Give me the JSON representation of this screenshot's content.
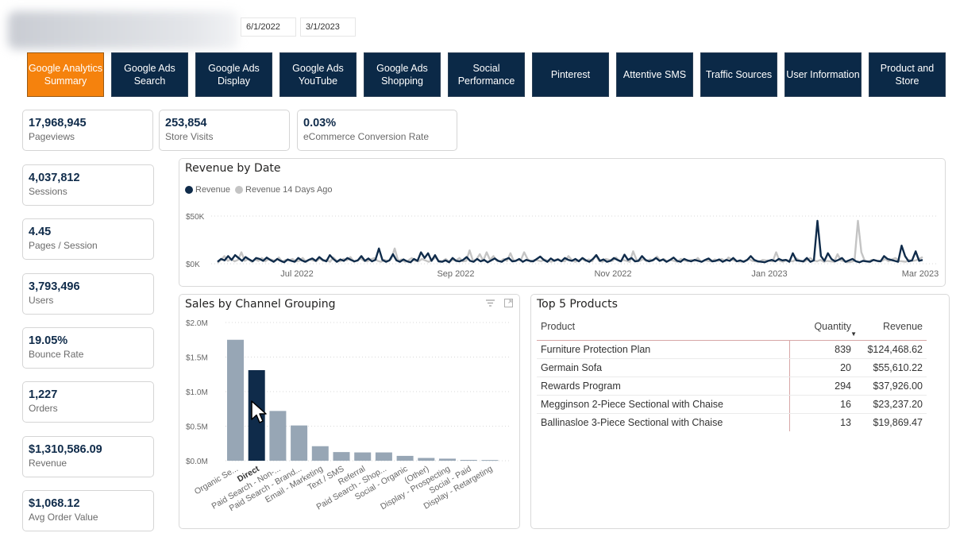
{
  "header": {
    "date_start": "6/1/2022",
    "date_end": "3/1/2023"
  },
  "nav": {
    "active_index": 0,
    "items": [
      {
        "label": "Google Analytics\nSummary"
      },
      {
        "label": "Google Ads\nSearch"
      },
      {
        "label": "Google Ads\nDisplay"
      },
      {
        "label": "Google Ads\nYouTube"
      },
      {
        "label": "Google Ads\nShopping"
      },
      {
        "label": "Social\nPerformance"
      },
      {
        "label": "Pinterest"
      },
      {
        "label": "Attentive SMS"
      },
      {
        "label": "Traffic Sources"
      },
      {
        "label": "User Information"
      },
      {
        "label": "Product and\nStore"
      }
    ]
  },
  "kpis_top": [
    {
      "value": "17,968,945",
      "label": "Pageviews"
    },
    {
      "value": "253,854",
      "label": "Store Visits"
    },
    {
      "value": "0.03%",
      "label": "eCommerce Conversion Rate"
    }
  ],
  "kpis_side": [
    {
      "value": "4,037,812",
      "label": "Sessions"
    },
    {
      "value": "4.45",
      "label": "Pages / Session"
    },
    {
      "value": "3,793,496",
      "label": "Users"
    },
    {
      "value": "19.05%",
      "label": "Bounce Rate"
    },
    {
      "value": "1,227",
      "label": "Orders"
    },
    {
      "value": "$1,310,586.09",
      "label": "Revenue"
    },
    {
      "value": "$1,068.12",
      "label": "Avg Order Value"
    }
  ],
  "colors": {
    "nav_bg": "#0b2947",
    "nav_active": "#f5820d",
    "series_revenue": "#0f2b4a",
    "series_prior": "#c4c4c4",
    "bar_default": "#97a6b5",
    "bar_selected": "#0f2b4a"
  },
  "revenue_chart": {
    "title": "Revenue by Date",
    "legend": [
      "Revenue",
      "Revenue 14 Days Ago"
    ]
  },
  "channel_chart": {
    "title": "Sales by Channel Grouping",
    "selected": "Direct"
  },
  "products": {
    "title": "Top 5 Products",
    "columns": [
      "Product",
      "Quantity",
      "Revenue"
    ],
    "sort_column": "Quantity",
    "rows": [
      {
        "product": "Furniture Protection Plan",
        "quantity": "839",
        "revenue": "$124,468.62"
      },
      {
        "product": "Germain Sofa",
        "quantity": "20",
        "revenue": "$55,610.22"
      },
      {
        "product": "Rewards Program",
        "quantity": "294",
        "revenue": "$37,926.00"
      },
      {
        "product": "Megginson 2-Piece Sectional with Chaise",
        "quantity": "16",
        "revenue": "$23,237.20"
      },
      {
        "product": "Ballinasloe 3-Piece Sectional with Chaise",
        "quantity": "13",
        "revenue": "$19,869.47"
      }
    ]
  },
  "chart_data": [
    {
      "type": "line",
      "title": "Revenue by Date",
      "xlabel": "",
      "ylabel": "",
      "x_tick_labels": [
        "Jul 2022",
        "Sep 2022",
        "Nov 2022",
        "Jan 2023",
        "Mar 2023"
      ],
      "y_tick_labels": [
        "$0K",
        "$50K"
      ],
      "ylim": [
        0,
        50000
      ],
      "x_range": [
        "2022-06-01",
        "2023-03-01"
      ],
      "legend_position": "top-left",
      "grid": true,
      "series": [
        {
          "name": "Revenue",
          "values": [
            2000,
            5000,
            3500,
            8000,
            4000,
            9000,
            6000,
            3000,
            7000,
            4500,
            2500,
            6000,
            5000,
            3000,
            6500,
            4000,
            2000,
            5000,
            3000,
            1500,
            4500,
            3000,
            2000,
            6000,
            3500,
            2000,
            4000,
            5500,
            3000,
            7000,
            4000,
            2500,
            9000,
            5000,
            2000,
            4500,
            3000,
            6000,
            4000,
            2500,
            3500,
            8000,
            3000,
            5500,
            2500,
            4000,
            16000,
            4000,
            2000,
            3500,
            10000,
            3500,
            2000,
            4500,
            2500,
            1500,
            5000,
            3000,
            12000,
            6000,
            11000,
            3000,
            9000,
            2500,
            2000,
            3500,
            1500,
            6000,
            3000,
            2500,
            4000,
            7000,
            3000,
            2000,
            5000,
            2500,
            4000,
            1500,
            3500,
            5500,
            3000,
            2000,
            4500,
            6000,
            2500,
            3000,
            5000,
            2000,
            4000,
            3000,
            2500,
            5000,
            7500,
            4000,
            2000,
            5500,
            3000,
            4500,
            2500,
            6000,
            4000,
            3000,
            5000,
            2500,
            6000,
            3500,
            2000,
            5000,
            9000,
            3000,
            4500,
            2000,
            3000,
            6000,
            4000,
            2500,
            9500,
            4000,
            6000,
            2500,
            3000,
            8000,
            4000,
            2500,
            3500,
            6000,
            3000,
            4500,
            2000,
            4000,
            6500,
            3000,
            2000,
            5000,
            3500,
            2500,
            4000,
            3000,
            2000,
            4000,
            5500,
            2500,
            3000,
            4500,
            2000,
            4000,
            3000,
            6000,
            2500,
            3500,
            2000,
            4000,
            8000,
            4000,
            2500,
            2000,
            1500,
            3000,
            4000,
            2500,
            5000,
            3500,
            4000,
            2000,
            11000,
            3500,
            3000,
            2500,
            6000,
            2000,
            3500,
            45000,
            8000,
            3000,
            11000,
            5000,
            2500,
            4000,
            6000,
            2000,
            3500,
            5000,
            2500,
            1500,
            3000,
            2500,
            2000,
            4000,
            3000,
            2500,
            8000,
            5000,
            4000,
            3000,
            2000,
            19000,
            8000,
            2500,
            3500,
            13000,
            3000,
            4000
          ]
        },
        {
          "name": "Revenue 14 Days Ago",
          "values": [
            1000,
            4000,
            8000,
            3000,
            5000,
            2500,
            4000,
            12000,
            3000,
            5000,
            2000,
            4500,
            3000,
            6000,
            2500,
            5000,
            4000,
            3000,
            6500,
            2000,
            4000,
            3500,
            5000,
            2500,
            3000,
            6000,
            2000,
            4500,
            3500,
            2500,
            5500,
            3000,
            4000,
            2000,
            6500,
            3000,
            2500,
            5000,
            3500,
            7000,
            2000,
            3500,
            5500,
            3000,
            2500,
            4500,
            6000,
            3000,
            2000,
            4000,
            3000,
            5000,
            16000,
            3000,
            4500,
            2000,
            3500,
            6000,
            3000,
            2500,
            5000,
            3500,
            2000,
            4000,
            6500,
            3000,
            2500,
            5000,
            2000,
            4000,
            3500,
            6000,
            2500,
            3000,
            14000,
            3000,
            4500,
            10000,
            3000,
            12000,
            4000,
            8000,
            3000,
            2500,
            5000,
            3000,
            11000,
            2500,
            4000,
            3500,
            12000,
            5000,
            2000,
            4000,
            3500,
            2500,
            4500,
            3000,
            2000,
            4000,
            5000,
            3000,
            2500,
            8000,
            4000,
            2000,
            3500,
            5000,
            3000,
            4500,
            2500,
            9000,
            3000,
            2000,
            5000,
            4000,
            3000,
            6500,
            2500,
            4000,
            3000,
            2000,
            13000,
            4000,
            3000,
            5000,
            2500,
            4500,
            3500,
            7500,
            3000,
            5000,
            2500,
            4000,
            3000,
            2000,
            5000,
            3500,
            2500,
            4000,
            3000,
            6000,
            2000,
            3500,
            3000,
            2500,
            4500,
            3000,
            5000,
            2500,
            6500,
            4000,
            3000,
            2500,
            2000,
            3500,
            5000,
            3000,
            2500,
            2000,
            4000,
            3500,
            3000,
            2500,
            12000,
            3000,
            2000,
            4000,
            3000,
            2500,
            5500,
            3000,
            2000,
            3500,
            6000,
            3500,
            2500,
            4000,
            2000,
            3000,
            2500,
            2000,
            10000,
            3500,
            2500,
            1500,
            2000,
            3000,
            45000,
            12000,
            3000,
            2000,
            4000,
            3500,
            2500,
            3000,
            5000,
            2500,
            4500,
            6000,
            3000,
            2500,
            2000,
            4000,
            3000,
            3500,
            5000,
            7000
          ]
        }
      ]
    },
    {
      "type": "bar",
      "title": "Sales by Channel Grouping",
      "xlabel": "",
      "ylabel": "",
      "categories": [
        "Organic Se...",
        "Direct",
        "Paid Search - Non-...",
        "Paid Search - Brand...",
        "Email - Marketing",
        "Text / SMS",
        "Referral",
        "Paid Search - Shop...",
        "Social - Organic",
        "(Other)",
        "Display - Prospecting",
        "Social - Paid",
        "Display - Retargeting"
      ],
      "values": [
        1750000,
        1310586,
        720000,
        510000,
        210000,
        125000,
        120000,
        120000,
        70000,
        40000,
        30000,
        12000,
        10000
      ],
      "y_tick_labels": [
        "$0.0M",
        "$0.5M",
        "$1.0M",
        "$1.5M",
        "$2.0M"
      ],
      "y_ticks": [
        0,
        500000,
        1000000,
        1500000,
        2000000
      ],
      "ylim": [
        0,
        2000000
      ],
      "grid": true,
      "highlighted_category": "Direct"
    },
    {
      "type": "table",
      "title": "Top 5 Products",
      "columns": [
        "Product",
        "Quantity",
        "Revenue"
      ],
      "rows": [
        [
          "Furniture Protection Plan",
          839,
          124468.62
        ],
        [
          "Germain Sofa",
          20,
          55610.22
        ],
        [
          "Rewards Program",
          294,
          37926.0
        ],
        [
          "Megginson 2-Piece Sectional with Chaise",
          16,
          23237.2
        ],
        [
          "Ballinasloe 3-Piece Sectional with Chaise",
          13,
          19869.47
        ]
      ]
    }
  ]
}
